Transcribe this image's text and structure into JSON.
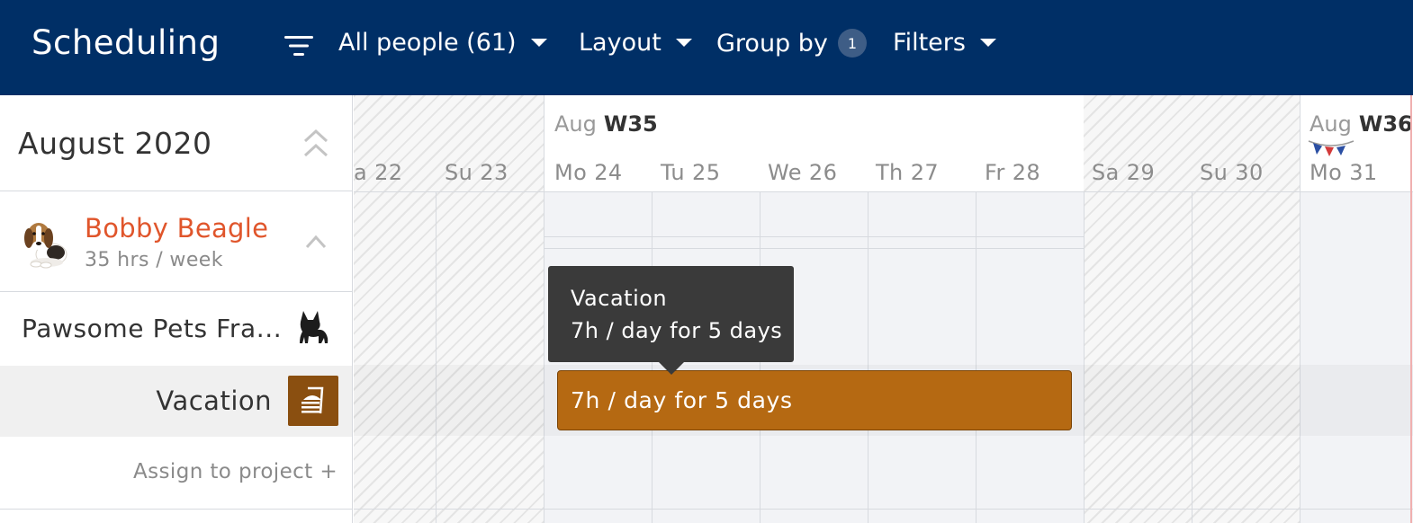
{
  "header": {
    "title": "Scheduling",
    "filter_icon": "filter-icon",
    "people_menu": "All people (61)",
    "layout_menu": "Layout",
    "group_by_label": "Group by",
    "group_by_count": "1",
    "filters_menu": "Filters",
    "background_color": "#002f66"
  },
  "sidebar": {
    "month": "August 2020",
    "person": {
      "name": "Bobby Beagle",
      "hours": "35 hrs / week",
      "name_color": "#e0552b"
    },
    "project": {
      "name": "Pawsome Pets Fra...",
      "icon": "french-bulldog-icon"
    },
    "task": {
      "name": "Vacation",
      "icon": "vacation-icon",
      "icon_color": "#8a4f10"
    },
    "assign_label": "Assign to project +"
  },
  "calendar": {
    "weeks": [
      {
        "month": "Aug",
        "week": "W35"
      },
      {
        "month": "Aug",
        "week": "W36"
      }
    ],
    "days": [
      "a 22",
      "Su 23",
      "Mo 24",
      "Tu 25",
      "We 26",
      "Th 27",
      "Fr 28",
      "Sa 29",
      "Su 30",
      "Mo 31"
    ],
    "allocation": {
      "text": "7h / day for 5 days",
      "color": "#b56912"
    },
    "tooltip": {
      "title": "Vacation",
      "detail": "7h / day for 5 days"
    },
    "holiday_icon": "holiday-bunting-icon"
  }
}
